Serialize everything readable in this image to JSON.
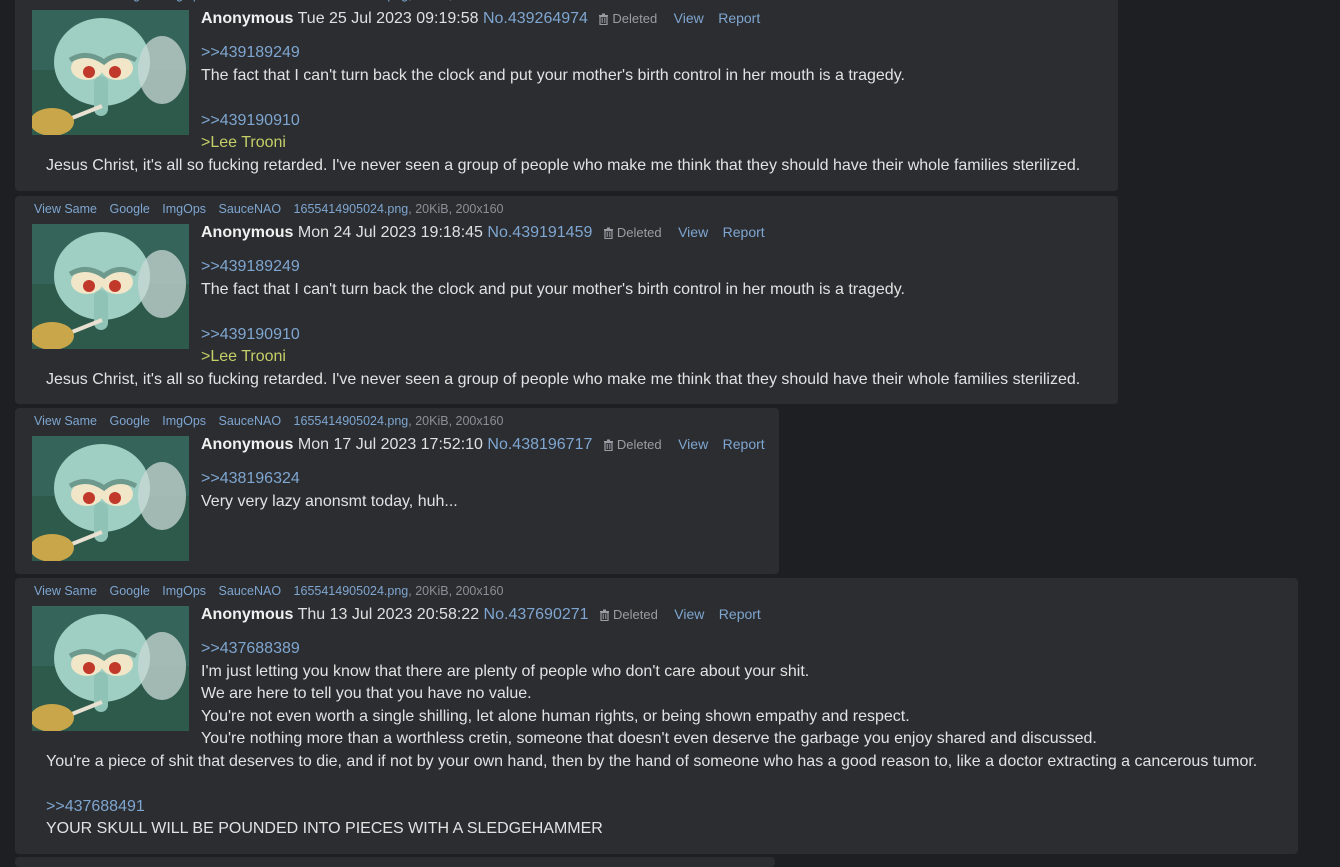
{
  "file_links": [
    "View Same",
    "Google",
    "ImgOps",
    "SauceNAO"
  ],
  "file": {
    "name": "1655414905024.png",
    "details": ", 20KiB, 200x160"
  },
  "actions": {
    "deleted": "Deleted",
    "view": "View",
    "report": "Report"
  },
  "posts": [
    {
      "name": "Anonymous",
      "date": "Tue 25 Jul 2023 09:19:58",
      "no": "No.439264974",
      "lines": [
        ">>439189249",
        "The fact that I can't turn back the clock and put your mother's birth control in her mouth is a tragedy.",
        "",
        ">>439190910",
        ">Lee Trooni",
        "Jesus Christ, it's all so fucking retarded. I've never seen a group of people who make me think that they should have their whole families sterilized."
      ]
    },
    {
      "name": "Anonymous",
      "date": "Mon 24 Jul 2023 19:18:45",
      "no": "No.439191459",
      "lines": [
        ">>439189249",
        "The fact that I can't turn back the clock and put your mother's birth control in her mouth is a tragedy.",
        "",
        ">>439190910",
        ">Lee Trooni",
        "Jesus Christ, it's all so fucking retarded. I've never seen a group of people who make me think that they should have their whole families sterilized."
      ]
    },
    {
      "name": "Anonymous",
      "date": "Mon 17 Jul 2023 17:52:10",
      "no": "No.438196717",
      "lines": [
        ">>438196324",
        "Very very lazy anonsmt today, huh..."
      ]
    },
    {
      "name": "Anonymous",
      "date": "Thu 13 Jul 2023 20:58:22",
      "no": "No.437690271",
      "lines": [
        ">>437688389",
        "I'm just letting you know that there are plenty of people who don't care about your shit.",
        "We are here to tell you that you have no value.",
        "You're not even worth a single shilling, let alone human rights, or being shown empathy and respect.",
        "You're nothing more than a worthless cretin, someone that doesn't even deserve the garbage you enjoy shared and discussed.",
        "You're a piece of shit that deserves to die, and if not by your own hand, then by the hand of someone who has a good reason to, like a doctor extracting a cancerous tumor.",
        "",
        ">>437688491",
        "YOUR SKULL WILL BE POUNDED INTO PIECES WITH A SLEDGEHAMMER"
      ]
    }
  ]
}
